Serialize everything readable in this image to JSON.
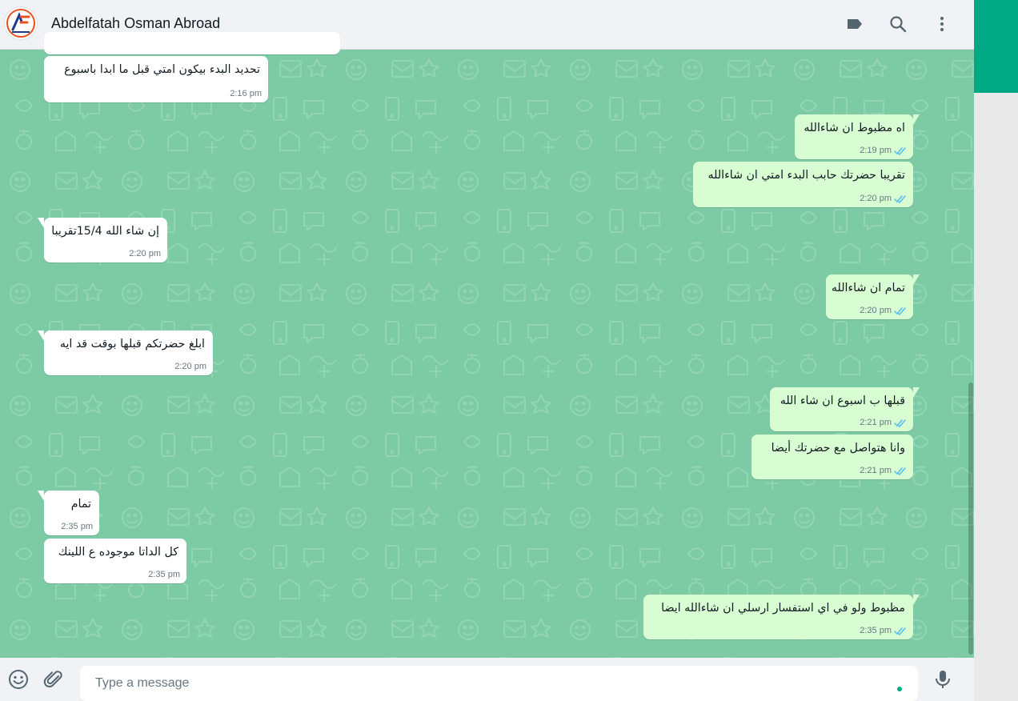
{
  "header": {
    "contact_name": "Abdelfatah Osman Abroad",
    "avatar_icon": "abdelfatah-osman-logo",
    "icons": [
      "label-icon",
      "search-icon",
      "menu-icon"
    ]
  },
  "colors": {
    "chat_background": "#7dcba4",
    "incoming_bubble": "#ffffff",
    "outgoing_bubble": "#d9fdd3",
    "read_tick": "#53bdeb",
    "accent": "#00a884"
  },
  "messages": [
    {
      "direction": "in",
      "text": "تحديد البدء بيكون امتي قبل ما ابدا باسبوع",
      "time": "2:16 pm"
    },
    {
      "direction": "out",
      "text": "اه مظبوط ان شاءالله",
      "time": "2:19 pm",
      "status": "read"
    },
    {
      "direction": "out",
      "text": "تقريبا حضرتك حابب البدء امتي ان شاءالله",
      "time": "2:20 pm",
      "status": "read"
    },
    {
      "direction": "in",
      "text": "إن شاء الله 15/4تقريبا",
      "time": "2:20 pm"
    },
    {
      "direction": "out",
      "text": "تمام ان شاءالله",
      "time": "2:20 pm",
      "status": "read"
    },
    {
      "direction": "in",
      "text": "ابلغ حضرتكم قبلها بوقت قد ايه",
      "time": "2:20 pm"
    },
    {
      "direction": "out",
      "text": "قبلها ب اسبوع ان شاء الله",
      "time": "2:21 pm",
      "status": "read"
    },
    {
      "direction": "out",
      "text": "وانا هتواصل مع حضرتك أيضا",
      "time": "2:21 pm",
      "status": "read"
    },
    {
      "direction": "in",
      "text": "تمام",
      "time": "2:35 pm"
    },
    {
      "direction": "in",
      "text": "كل الداتا موجوده ع اللينك",
      "time": "2:35 pm"
    },
    {
      "direction": "out",
      "text": "مظبوط ولو في اي استفسار ارسلي ان شاءالله ايضا",
      "time": "2:35 pm",
      "status": "read"
    }
  ],
  "composer": {
    "placeholder": "Type a message",
    "value": "",
    "icons": [
      "emoji-icon",
      "attach-icon",
      "mic-icon"
    ]
  }
}
